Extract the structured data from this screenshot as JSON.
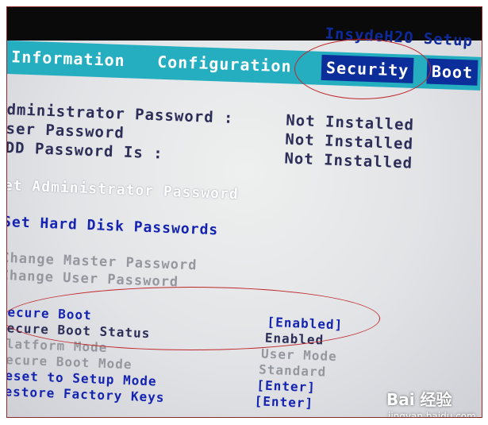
{
  "header": {
    "brand": "InsydeH2O Setup"
  },
  "menu": {
    "tabs": [
      {
        "label": "Information"
      },
      {
        "label": "Configuration"
      },
      {
        "label": "Security",
        "selected": true
      },
      {
        "label": "Boot"
      }
    ]
  },
  "security": {
    "admin_password": {
      "label": "dministrator Password :",
      "value": "Not Installed"
    },
    "user_password": {
      "label": "ser Password",
      "value": "Not Installed"
    },
    "hdd_password": {
      "label": "DD Password Is :",
      "value": "Not Installed"
    },
    "set_admin_password": "et Administrator Password",
    "set_hdd_passwords": "Set Hard Disk Passwords",
    "change_master_password": "Change Master Password",
    "change_user_password": "Change User Password",
    "secure_boot": {
      "label": "Secure Boot",
      "value": "[Enabled]"
    },
    "secure_boot_status": {
      "label": "Secure Boot Status",
      "value": "Enabled"
    },
    "platform_mode": {
      "label": "Platform Mode",
      "value": "User Mode"
    },
    "secure_boot_mode": {
      "label": "Secure Boot Mode",
      "value": "Standard"
    },
    "reset_setup_mode": {
      "label": "Reset to Setup Mode",
      "value": "[Enter]"
    },
    "restore_factory_keys": {
      "label": "Restore Factory Keys",
      "value": "[Enter]"
    }
  },
  "watermark": {
    "logo": "Bai  经验",
    "url": "jingyan.baidu.com"
  },
  "colors": {
    "menubar": "#25aec0",
    "selected_tab": "#0b2e9a",
    "annotation_circle": "#c0262a"
  }
}
